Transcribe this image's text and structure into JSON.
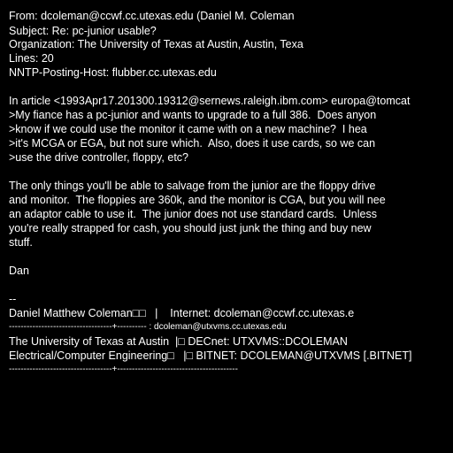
{
  "theme": {
    "background": "#000000",
    "text_color": "#ffffff"
  },
  "headers": {
    "from": "From: dcoleman@ccwf.cc.utexas.edu (Daniel M. Coleman",
    "subject": "Subject: Re: pc-junior usable?",
    "organization": "Organization: The University of Texas at Austin, Austin, Texa",
    "lines": "Lines: 20",
    "nntp_host": "NNTP-Posting-Host: flubber.cc.utexas.edu"
  },
  "quote": {
    "attribution": "In article <1993Apr17.201300.19312@sernews.raleigh.ibm.com> europa@tomcat",
    "lines": [
      ">My fiance has a pc-junior and wants to upgrade to a full 386.  Does anyon",
      ">know if we could use the monitor it came with on a new machine?  I hea",
      ">it's MCGA or EGA, but not sure which.  Also, does it use cards, so we can",
      ">use the drive controller, floppy, etc?"
    ]
  },
  "body": {
    "lines": [
      "The only things you'll be able to salvage from the junior are the floppy drive",
      "and monitor.  The floppies are 360k, and the monitor is CGA, but you will nee",
      "an adaptor cable to use it.  The junior does not use standard cards.  Unless",
      "you're really strapped for cash, you should just junk the thing and buy new",
      "stuff."
    ],
    "signoff": "Dan"
  },
  "signature": {
    "dashes": "--",
    "lines": [
      "Daniel Matthew Coleman□□   |    Internet: dcoleman@ccwf.cc.utexas.e",
      "-----------------------------------+---------- : dcoleman@utxvms.cc.utexas.edu",
      "The University of Texas at Austin  |□ DECnet: UTXVMS::DCOLEMAN",
      "Electrical/Computer Engineering□   |□ BITNET: DCOLEMAN@UTXVMS [.BITNET]",
      "-----------------------------------+-----------------------------------------"
    ]
  }
}
